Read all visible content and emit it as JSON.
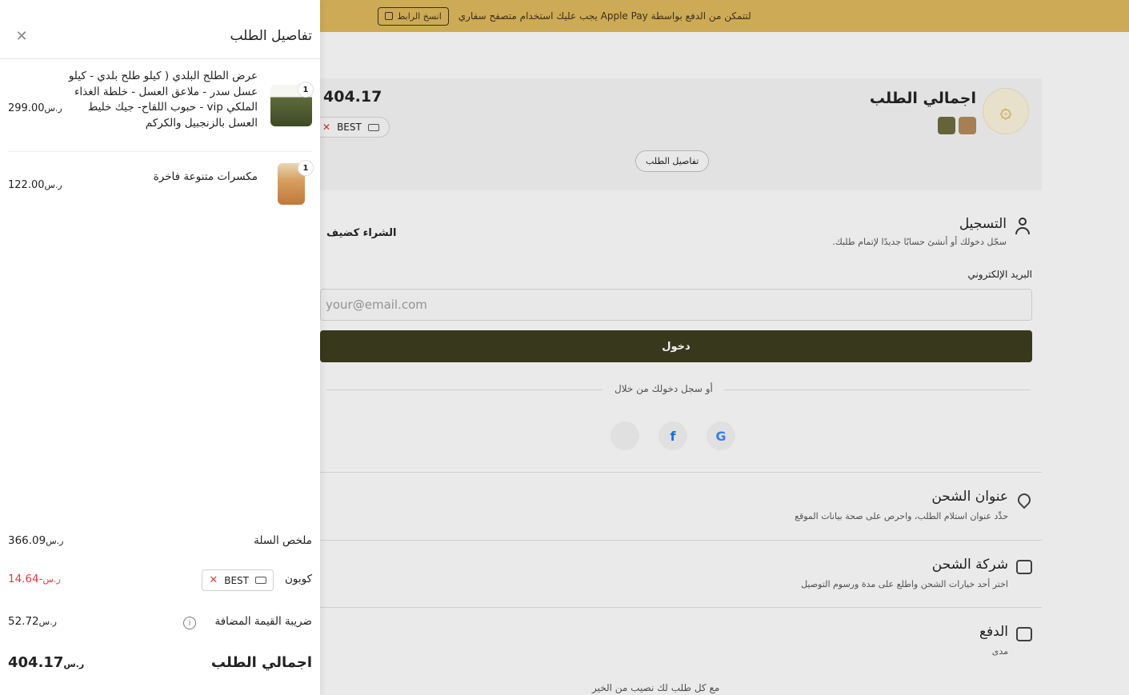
{
  "banner": {
    "message": "لتتمكن من الدفع بواسطة Apple Pay يجب عليك استخدام متصفح سفاري",
    "copy_label": "انسخ الرابط"
  },
  "order_summary": {
    "title": "اجمالي الطلب",
    "total": "404.17",
    "coupon_code": "BEST",
    "details_button": "تفاصيل الطلب"
  },
  "registration": {
    "title": "التسجيل",
    "subtitle": "سجّل دخولك أو أنشئ حسابًا جديدًا لإتمام طلبك.",
    "guest_button": "الشراء كضيف",
    "email_label": "البريد الإلكتروني",
    "email_placeholder": "your@email.com",
    "login_button": "دخول",
    "social_divider": "أو سجل دخولك من خلال"
  },
  "sections": {
    "shipping_address": {
      "title": "عنوان الشحن",
      "subtitle": "حدِّد عنوان استلام الطلب، واحرص على صحة بيانات الموقع"
    },
    "shipping_company": {
      "title": "شركة الشحن",
      "subtitle": "اختر أحد خيارات الشحن واطلع على مدة ورسوم التوصيل"
    },
    "payment": {
      "title": "الدفع",
      "subtitle": "مدى"
    }
  },
  "footer": {
    "text": "مع كل طلب لك نصيب من الخير"
  },
  "drawer": {
    "title": "تفاصيل الطلب",
    "items": [
      {
        "name": "عرض الطلح البلدي ( كيلو طلح بلدي - كيلو عسل سدر - ملاعق العسل - خلطة الغذاء الملكي vip - حبوب اللقاح- جيك خليط العسل بالزنجبيل والكركم",
        "qty": "1",
        "price": "299.00"
      },
      {
        "name": "مكسرات متنوعة فاخرة",
        "qty": "1",
        "price": "122.00"
      }
    ],
    "summary": {
      "cart_label": "ملخص السلة",
      "cart_value": "366.09",
      "coupon_label": "كوبون",
      "coupon_code": "BEST",
      "coupon_value": "-14.64",
      "vat_label": "ضريبة القيمة المضافة",
      "vat_value": "52.72",
      "total_label": "اجمالي الطلب",
      "total_value": "404.17"
    },
    "currency_symbol": "ر.س"
  },
  "colors": {
    "banner": "#d9b45a",
    "login_button": "#3c3c1f",
    "discount": "#e0393e"
  }
}
